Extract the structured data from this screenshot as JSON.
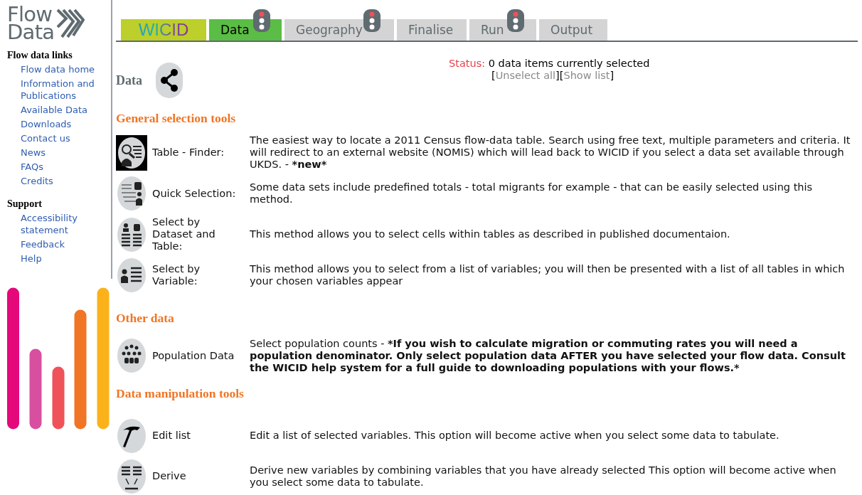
{
  "logo": {
    "line_1": "Flow",
    "line_2": "Data"
  },
  "sidebar": {
    "sections": [
      {
        "heading": "Flow data links",
        "links": [
          "Flow data home",
          "Information and Publications",
          "Available Data",
          "Downloads",
          "Contact us",
          "News",
          "FAQs",
          "Credits"
        ]
      },
      {
        "heading": "Support",
        "links": [
          "Accessibility statement",
          "Feedback",
          "Help"
        ]
      }
    ]
  },
  "wicid_logo": "WICID",
  "tabs": [
    {
      "label": "Data",
      "selected": true,
      "indicator": true
    },
    {
      "label": "Geography",
      "selected": false,
      "indicator": true
    },
    {
      "label": "Finalise",
      "selected": false,
      "indicator": false
    },
    {
      "label": "Run",
      "selected": false,
      "indicator": true
    },
    {
      "label": "Output",
      "selected": false,
      "indicator": false
    }
  ],
  "page": {
    "title": "Data"
  },
  "status": {
    "label": "Status:",
    "text": "0 data items currently selected",
    "actions": [
      {
        "open": "[",
        "label": "Unselect all",
        "close": "]"
      },
      {
        "open": "[",
        "label": "Show list",
        "close": "]"
      }
    ]
  },
  "sections": [
    {
      "heading": "General selection tools",
      "tools": [
        {
          "kind": "finder",
          "label": "Table - Finder:",
          "description": [
            {
              "text": "The easiest way to locate a 2011 Census flow-data table. Search using free text, multiple parameters and criteria. It will redirect to an external website (NOMIS) which will lead back to WICID if you select a data set available through UKDS. - ",
              "bold": false
            },
            {
              "text": "*new*",
              "bold": true
            }
          ]
        },
        {
          "kind": "quick",
          "label": "Quick Selection:",
          "description": [
            {
              "text": "Some data sets include predefined totals - total migrants for example - that can be easily selected using this method.",
              "bold": false
            }
          ]
        },
        {
          "kind": "dataset",
          "label": "Select by Dataset and Table:",
          "description": [
            {
              "text": "This method allows you to select cells within tables as described in published documentaion.",
              "bold": false
            }
          ]
        },
        {
          "kind": "variable",
          "label": "Select by Variable:",
          "description": [
            {
              "text": "This method allows you to select from a list of variables; you will then be presented with a list of all tables in which your chosen variables appear",
              "bold": false
            }
          ]
        }
      ]
    },
    {
      "heading": "Other data",
      "tools": [
        {
          "kind": "population",
          "label": "Population Data",
          "description": [
            {
              "text": "Select population counts - ",
              "bold": false
            },
            {
              "text": "*If you wish to calculate migration or commuting rates you will need a population denominator. Only select population data AFTER you have selected your flow data. Consult the WICID help system for a full guide to downloading populations with your flows.*",
              "bold": true
            }
          ]
        }
      ]
    },
    {
      "heading": "Data manipulation tools",
      "tools": [
        {
          "kind": "edit",
          "label": "Edit list",
          "description": [
            {
              "text": "Edit a list of selected variables. This option will become active when you select some data to tabulate.",
              "bold": false
            }
          ]
        },
        {
          "kind": "derive",
          "label": "Derive",
          "description": [
            {
              "text": "Derive new variables by combining variables that you have already selected This option will become active when you select some data to tabulate.",
              "bold": false
            }
          ]
        }
      ]
    }
  ]
}
